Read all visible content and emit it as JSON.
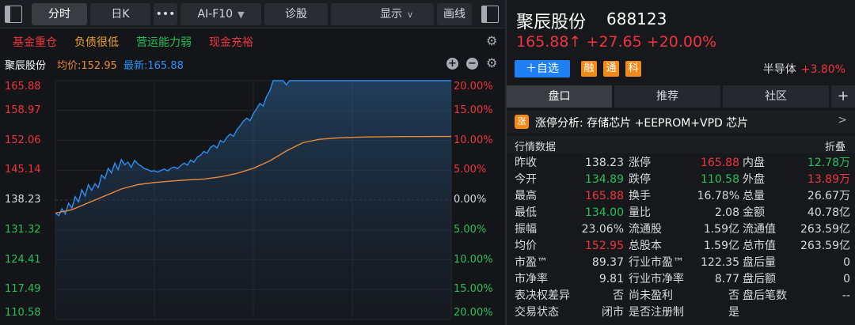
{
  "toolbar": {
    "tabs": [
      "分时",
      "日K"
    ],
    "more": "•••",
    "f10": "AI-F10",
    "diagnose": "诊股",
    "display": "显示",
    "draw": "画线"
  },
  "tags": [
    {
      "label": "基金重仓",
      "color": "#f0343e"
    },
    {
      "label": "负债很低",
      "color": "#f0a32d"
    },
    {
      "label": "营运能力弱",
      "color": "#26c05a"
    },
    {
      "label": "现金充裕",
      "color": "#f0343e"
    }
  ],
  "chart_header": {
    "name": "聚辰股份",
    "avg_label": "均价:152.95",
    "latest_label": "最新:165.88"
  },
  "chart_data": {
    "type": "line",
    "left_ticks": [
      "165.88",
      "158.97",
      "152.06",
      "145.14",
      "138.23",
      "131.32",
      "124.41",
      "117.49",
      "110.58"
    ],
    "right_ticks": [
      "20.00%",
      "15.00%",
      "10.00%",
      "5.00%",
      "0.00%",
      "5.00%",
      "10.00%",
      "15.00%",
      "20.00%"
    ],
    "ylim": [
      110.58,
      165.88
    ],
    "prev_close": 138.23,
    "series": [
      {
        "name": "最新",
        "color": "#2b90f5",
        "x": [
          0,
          2,
          4,
          6,
          8,
          10,
          12,
          14,
          16,
          18,
          20,
          22,
          24,
          26,
          28,
          30,
          32,
          34,
          36,
          38,
          40,
          42,
          44,
          46,
          48,
          50,
          52,
          54,
          56,
          58,
          60,
          62,
          64,
          66,
          68,
          70,
          72,
          74,
          76,
          78,
          80,
          82,
          84,
          86,
          88,
          90,
          92,
          94,
          96,
          98,
          100,
          102,
          104,
          106,
          108,
          110,
          112,
          114,
          116,
          118,
          120,
          122,
          124,
          126,
          128,
          130,
          132,
          134,
          136,
          138,
          140,
          142,
          144,
          146,
          148,
          150,
          152,
          154,
          156,
          158,
          160,
          162,
          164,
          166,
          168,
          170,
          172,
          174,
          176,
          178,
          180,
          182,
          184,
          186,
          188,
          190,
          192,
          194,
          196,
          198,
          200,
          202,
          204,
          206,
          208,
          210,
          212,
          214,
          216,
          218,
          220,
          222,
          224,
          226,
          228,
          230,
          232,
          234,
          236,
          238,
          240
        ],
        "values": [
          135.2,
          134.6,
          136.2,
          135.0,
          137.5,
          136.4,
          139.0,
          137.8,
          140.6,
          139.2,
          141.8,
          140.5,
          142.0,
          141.1,
          144.0,
          143.2,
          145.6,
          144.5,
          146.8,
          145.3,
          147.6,
          146.4,
          147.0,
          145.8,
          147.4,
          146.6,
          146.1,
          145.5,
          145.3,
          144.9,
          145.0,
          144.7,
          145.1,
          145.4,
          145.0,
          145.6,
          145.9,
          145.5,
          146.2,
          146.8,
          146.3,
          147.5,
          147.0,
          148.2,
          148.6,
          149.5,
          149.1,
          150.4,
          150.9,
          150.3,
          152.0,
          151.6,
          152.8,
          153.5,
          153.0,
          154.5,
          155.4,
          156.5,
          157.2,
          156.6,
          158.2,
          159.4,
          160.6,
          160.0,
          162.2,
          163.5,
          165.88,
          165.88,
          165.88,
          165.88,
          164.9,
          165.88,
          165.88,
          165.88,
          165.88,
          165.88,
          165.88,
          165.88,
          165.88,
          165.88,
          165.88,
          165.88,
          165.88,
          165.88,
          165.88,
          165.88,
          165.88,
          165.88,
          165.88,
          165.88,
          165.88,
          165.88,
          165.88,
          165.88,
          165.88,
          165.88,
          165.88,
          165.88,
          165.88,
          165.88,
          165.88,
          165.88,
          165.88,
          165.88,
          165.88,
          165.88,
          165.88,
          165.88,
          165.88,
          165.88,
          165.88,
          165.88,
          165.88,
          165.88,
          165.88,
          165.88,
          165.88,
          165.88,
          165.88,
          165.88,
          165.88
        ]
      },
      {
        "name": "均价",
        "color": "#e8893a",
        "x": [
          0,
          10,
          20,
          30,
          40,
          50,
          60,
          70,
          80,
          90,
          100,
          110,
          120,
          130,
          140,
          150,
          160,
          170,
          180,
          190,
          200,
          210,
          220,
          230,
          240
        ],
        "values": [
          135.2,
          136.0,
          137.6,
          139.2,
          140.8,
          141.8,
          142.3,
          142.6,
          142.9,
          143.1,
          143.6,
          144.4,
          145.6,
          147.3,
          149.6,
          151.5,
          152.3,
          152.6,
          152.75,
          152.85,
          152.9,
          152.93,
          152.94,
          152.95,
          152.95
        ]
      }
    ]
  },
  "quote": {
    "name": "聚辰股份",
    "code": "688123",
    "price": "165.88↑",
    "change": "+27.65",
    "pct": "+20.00%",
    "add_label": "＋自选",
    "badges": [
      "融",
      "通",
      "科"
    ],
    "sector_name": "半导体",
    "sector_pct": "+3.80%"
  },
  "tabs": [
    "盘口",
    "推荐",
    "社区"
  ],
  "tab_add": "+",
  "analysis": {
    "icon": "涨",
    "text": "涨停分析: 存储芯片 +EEPROM+VPD 芯片",
    "arrow": ">"
  },
  "market": {
    "title": "行情数据",
    "fold": "折叠",
    "rows": [
      [
        [
          "昨收",
          "138.23",
          "white"
        ],
        [
          "涨停",
          "165.88",
          "red"
        ],
        [
          "内盘",
          "12.78万",
          "green"
        ]
      ],
      [
        [
          "今开",
          "134.89",
          "green"
        ],
        [
          "跌停",
          "110.58",
          "green"
        ],
        [
          "外盘",
          "13.89万",
          "red"
        ]
      ],
      [
        [
          "最高",
          "165.88",
          "red"
        ],
        [
          "换手",
          "16.78%",
          "white"
        ],
        [
          "总量",
          "26.67万",
          "white"
        ]
      ],
      [
        [
          "最低",
          "134.00",
          "green"
        ],
        [
          "量比",
          "2.08",
          "white"
        ],
        [
          "金额",
          "40.78亿",
          "white"
        ]
      ],
      [
        [
          "振幅",
          "23.06%",
          "white"
        ],
        [
          "流通股",
          "1.59亿",
          "white"
        ],
        [
          "流通值",
          "263.59亿",
          "white"
        ]
      ],
      [
        [
          "均价",
          "152.95",
          "red"
        ],
        [
          "总股本",
          "1.59亿",
          "white"
        ],
        [
          "总市值",
          "263.59亿",
          "white"
        ]
      ],
      [
        [
          "市盈™",
          "89.37",
          "white"
        ],
        [
          "行业市盈™",
          "122.35",
          "white"
        ],
        [
          "盘后量",
          "0",
          "white"
        ]
      ],
      [
        [
          "市净率",
          "9.81",
          "white"
        ],
        [
          "行业市净率",
          "8.77",
          "white"
        ],
        [
          "盘后额",
          "0",
          "white"
        ]
      ],
      [
        [
          "表决权差异",
          "否",
          "white"
        ],
        [
          "尚未盈利",
          "否",
          "white"
        ],
        [
          "盘后笔数",
          "--",
          "white"
        ]
      ],
      [
        [
          "交易状态",
          "闭市",
          "white"
        ],
        [
          "是否注册制",
          "是",
          "white"
        ],
        [
          "",
          "",
          " white"
        ]
      ]
    ]
  },
  "colors": {
    "up": "#f0343e",
    "down": "#26c05a",
    "accent": "#1f80f2",
    "badge": "#f08a19"
  }
}
